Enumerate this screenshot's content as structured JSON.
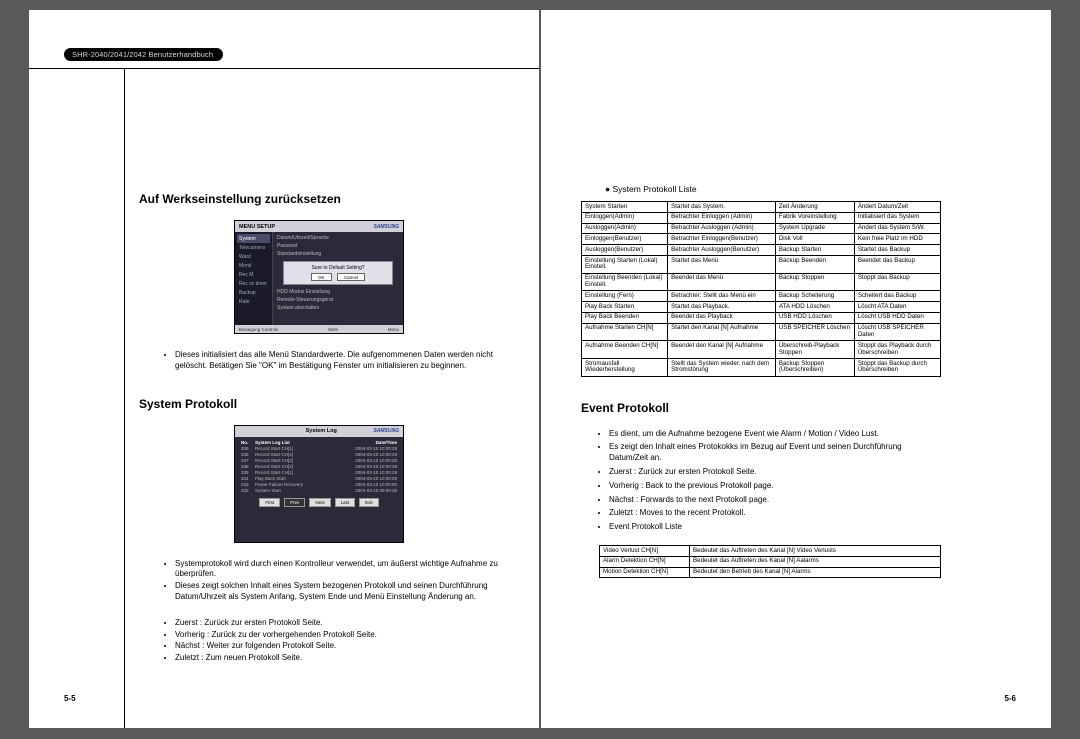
{
  "header_badge": "SHR-2040/2041/2042 Benutzerhandbuch",
  "page_num_left": "5-5",
  "page_num_right": "5-6",
  "left": {
    "h1": "Auf Werkseinstellung zurücksetzen",
    "ss1": {
      "title": "MENU SETUP",
      "brand": "SAMSUNG",
      "sidebar": [
        "System",
        "Telecamera",
        "Ward",
        "Monit",
        "Rec M",
        "Rec sc timer",
        "Backup",
        "Rate"
      ],
      "lines_top": [
        "Datum/Uhrzeit/Sprache",
        "Passwort",
        "Standardeinstellung"
      ],
      "dialog_text": "Sure to Default Setting?",
      "dialog_ok": "OK",
      "dialog_cancel": "Cancel",
      "lines_bot": [
        "HDD Modus Einstellung",
        "Remote-Steuerungsgerat",
        "System abschalten"
      ],
      "footer_left": "Bewegung Controls",
      "footer_mid": "Wahl",
      "footer_right": "Menu"
    },
    "bullets1": [
      "Dieses initialisiert das alle Menü Standardwerte. Die aufgenommenen Daten werden nicht gelöscht. Betätigen Sie \"OK\" im Bestätigung Fenster um initialisieren zu beginnen."
    ],
    "h2": "System Protokoll",
    "ss2": {
      "title": "System Log",
      "brand": "SAMSUNG",
      "hdr": {
        "no": "No.",
        "list": "System Log List",
        "date": "Date/Time"
      },
      "rows": [
        {
          "no": "339",
          "list": "Record Start CH[1]",
          "date": "2004-03-10 10:00:29"
        },
        {
          "no": "338",
          "list": "Record Start CH[4]",
          "date": "2004-03-10 10:00:29"
        },
        {
          "no": "337",
          "list": "Record Start CH[3]",
          "date": "2004-03-10 10:00:28"
        },
        {
          "no": "336",
          "list": "Record Start CH[2]",
          "date": "2004-03-10 10:00:28"
        },
        {
          "no": "335",
          "list": "Record Start CH[1]",
          "date": "2004-03-10 10:00:28"
        },
        {
          "no": "334",
          "list": "Play Back Start",
          "date": "2004-03-10 10:00:08"
        },
        {
          "no": "333",
          "list": "Power Failure Recovery",
          "date": "2004-03-10 10:00:00"
        },
        {
          "no": "332",
          "list": "System Start",
          "date": "2004-03-10 09:59:38"
        }
      ],
      "nav": [
        "First",
        "Prev",
        "Next",
        "Last",
        "Exit"
      ]
    },
    "bullets2": [
      "Systemprotokoll wird durch einen Kontrolleur verwendet, um äußerst wichtige Aufnahme zu überprüfen.",
      "Dieses zeigt solchen Inhalt eines System bezogenen Protokoll und seinen Durchführung Datum/Uhrzeit als System Anfang, System Ende und Menü Einstellung Änderung an."
    ],
    "bullets3": [
      "Zuerst : Zurück zur ersten Protokoll Seite.",
      "Vorherig : Zurück zu der vorhergehenden Protokoll Seite.",
      "Nächst : Weiter zur folgenden Protokoll Seite.",
      "Zuletzt : Zum neuen Protokoll Seite."
    ]
  },
  "right": {
    "sub1": "System Protokoll Liste",
    "sys_table": [
      [
        "System Starten",
        "Startet das System.",
        "Zeit Änderung",
        "Ändert Datum/Zeit"
      ],
      [
        "Einloggen(Admin)",
        "Betrachter Einloggen (Admin)",
        "Fabrik Voreinstellung",
        "Initialisiert das System"
      ],
      [
        "Ausloggen(Admin)",
        "Betrachter Ausloggen (Admin)",
        "System Upgrade",
        "Ändert das System S/W."
      ],
      [
        "Einloggen(Benutzer)",
        "Betrachter Einloggen(Benutzer)",
        "Disk Voll",
        "Kein freie Platz im HDD"
      ],
      [
        "Ausloggen(Benutzer)",
        "Betrachter Ausloggen(Benutzer)",
        "Backup Starten",
        "Startet das Backup"
      ],
      [
        "Einstellung Starten (Lokal) Einstell.",
        "Startet das Menü",
        "Backup Beenden",
        "Beendet das Backup"
      ],
      [
        "Einstellung Beenden (Lokal) Einstell.",
        "Beendet das Menü",
        "Backup Stoppen",
        "Stoppt das Backup"
      ],
      [
        "Einstellung (Fern)",
        "Betrachter: Stellt das Menü ein",
        "Backup Scheiterung",
        "Scheitert das Backup"
      ],
      [
        "Play Back Starten",
        "Startet das Playback.",
        "ATA HDD Löschen",
        "Löscht ATA Daten"
      ],
      [
        "Play Back Beenden",
        "Beendet das Playback",
        "USB HDD Löschen",
        "Löscht USB HDD Daten"
      ],
      [
        "Aufnahme Starten CH[N]",
        "Startet den Kanal [N] Aufnahme",
        "USB SPEICHER Löschen",
        "Löscht USB SPEICHER Daten"
      ],
      [
        "Aufnahme Beenden CH[N]",
        "Beendet den Kanal [N] Aufnahme",
        "Überschreib-Playback Stoppen",
        "Stoppt das Playback durch Überschreiben"
      ],
      [
        "Stromausfall Wiederherstellung",
        "Stellt das System wieder. nach dem Stromstörung",
        "Backup Stoppen (Überschreiben)",
        "Stoppt das Backup durch Überschreiben"
      ]
    ],
    "h1": "Event Protokoll",
    "bullets1": [
      "Es dient, um die Aufnahme bezogene Event wie Alarm / Motion / Video Lust.",
      "Es zeigt den Inhalt eines Protokokks im Bezug auf Event und seinen Durchführung Datum/Zeit an.",
      "Zuerst : Zurück zur ersten Protokoll Seite.",
      "Vorherig : Back to the previous Protokoll page.",
      "Nächst : Forwards to the next Protokoll page.",
      "Zuletzt : Moves to the recent Protokoll.",
      "Event Protokoll Liste"
    ],
    "event_table": [
      [
        "Video Verlust CH[N]",
        "Bedeutet das Auftreten des Kanal [N] Video Verlusts"
      ],
      [
        "Alarm Detektion CH[N]",
        "Bedeutet das Auftreten des Kanal [N] Aalarms"
      ],
      [
        "Motion Detektion CH[N]",
        "Bedeutet den Betrieb des Kanal [N] Alarms"
      ]
    ]
  }
}
